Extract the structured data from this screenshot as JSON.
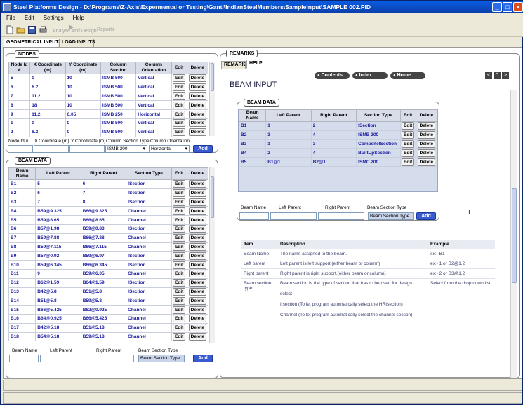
{
  "window": {
    "title": "Steel Platforms Design - D:\\Programs\\Z-Axis\\Expermental or Testing\\Ganti\\IndianSteelMembers\\SampleInput\\SAMPLE 002.PID"
  },
  "menu": [
    "File",
    "Edit",
    "Settings",
    "Help"
  ],
  "toolbar": {
    "analyse_label": "Analyse And Design",
    "reports_label": "Reports"
  },
  "tabs": [
    "GEOMETRICAL INPUTS",
    "LOAD INPUTS"
  ],
  "nodes": {
    "legend": "NODES",
    "headers": [
      "Node Id #",
      "X Coordinate (m)",
      "Y Coordinate (m)",
      "Column Section",
      "Column Orientation",
      "Edit",
      "Delete"
    ],
    "rows": [
      [
        "5",
        "0",
        "10",
        "ISMB 500",
        "Vertical"
      ],
      [
        "6",
        "6.2",
        "10",
        "ISMB 500",
        "Vertical"
      ],
      [
        "7",
        "11.2",
        "10",
        "ISMB 500",
        "Vertical"
      ],
      [
        "8",
        "18",
        "10",
        "ISMB 500",
        "Vertical"
      ],
      [
        "9",
        "11.2",
        "6.05",
        "ISMB 250",
        "Horizontal"
      ],
      [
        "1",
        "0",
        "0",
        "ISMB 500",
        "Vertical"
      ],
      [
        "2",
        "6.2",
        "0",
        "ISMB 500",
        "Vertical"
      ]
    ],
    "form": {
      "node_id_label": "Node Id #",
      "x_label": "X Coordinate (m)",
      "y_label": "Y Coordinate (m)",
      "section_label": "Column Section Type",
      "orientation_label": "Column Orientation",
      "section_value": "ISMB 200",
      "orientation_value": "Horizontal",
      "add": "Add"
    }
  },
  "edit_label": "Edit",
  "delete_label": "Delete",
  "beams": {
    "legend": "BEAM DATA",
    "headers": [
      "Beam Name",
      "Left Parent",
      "Right Parent",
      "Section Type",
      "Edit",
      "Delete"
    ],
    "rows": [
      [
        "B1",
        "5",
        "6",
        "ISection"
      ],
      [
        "B2",
        "6",
        "7",
        "ISection"
      ],
      [
        "B3",
        "7",
        "8",
        "ISection"
      ],
      [
        "B4",
        "B59@9.325",
        "B66@9.325",
        "Channel"
      ],
      [
        "B5",
        "B59@8.65",
        "B66@8.65",
        "Channel"
      ],
      [
        "B6",
        "B57@1.98",
        "B59@0.83",
        "ISection"
      ],
      [
        "B7",
        "B59@7.88",
        "B66@7.88",
        "Channel"
      ],
      [
        "B8",
        "B59@7.115",
        "B66@7.115",
        "Channel"
      ],
      [
        "B9",
        "B57@0.92",
        "B59@6.97",
        "ISection"
      ],
      [
        "B10",
        "B59@6.345",
        "B66@6.345",
        "ISection"
      ],
      [
        "B11",
        "9",
        "B59@6.05",
        "Channel"
      ],
      [
        "B12",
        "B62@1.59",
        "B64@1.59",
        "ISection"
      ],
      [
        "B13",
        "B42@5.8",
        "B51@5.8",
        "ISection"
      ],
      [
        "B14",
        "B51@5.8",
        "B59@5.8",
        "ISection"
      ],
      [
        "B15",
        "B66@5.425",
        "B62@0.925",
        "Channel"
      ],
      [
        "B16",
        "B64@0.925",
        "B66@5.425",
        "Channel"
      ],
      [
        "B17",
        "B42@5.18",
        "B51@5.18",
        "Channel"
      ],
      [
        "B18",
        "B54@5.18",
        "B59@5.18",
        "Channel"
      ]
    ],
    "form": {
      "name_label": "Beam Name",
      "left_label": "Left Parent",
      "right_label": "Right Parent",
      "section_label": "Beam Section Type",
      "section_value": "Beam Section Type",
      "add": "Add"
    }
  },
  "remarks": {
    "legend": "REMARKS",
    "tabs": [
      "REMARKS",
      "HELP"
    ],
    "nav": [
      "Contents",
      "Index",
      "Home"
    ],
    "nav_arrows": [
      "<",
      "^",
      ">"
    ],
    "heading": "BEAM INPUT",
    "sample": {
      "legend": "BEAM DATA",
      "headers": [
        "Beam Name",
        "Left Parent",
        "Right Parent",
        "Section Type",
        "Edit",
        "Delete"
      ],
      "rows": [
        [
          "B1",
          "1",
          "2",
          "ISection"
        ],
        [
          "B2",
          "3",
          "4",
          "ISMB 200"
        ],
        [
          "B3",
          "1",
          "3",
          "CompsiteISection"
        ],
        [
          "B4",
          "2",
          "4",
          "BuiltUpSection"
        ],
        [
          "B5",
          "B1@1",
          "B2@1",
          "ISMC 200"
        ]
      ],
      "form": {
        "name_label": "Beam Name",
        "left_label": "Left Parent",
        "right_label": "Right Parent",
        "section_label": "Beam Section Type",
        "section_value": "Beam Section Type",
        "add": "Add"
      }
    },
    "desc_headers": [
      "Item",
      "Description",
      "Example"
    ],
    "desc_rows": [
      {
        "item": "Beam Name",
        "desc": "The name assigned to the beam.",
        "example": "ex:- B1"
      },
      {
        "item": "Left parent",
        "desc": "Left parent is left support.(either beam or column)",
        "example": "ex:- 1 or B2@1.2"
      },
      {
        "item": "Right parent",
        "desc": "Right parent is right support.(either beam or column)",
        "example": "ex:- 2 or B3@1.2"
      },
      {
        "item": "Beam section type",
        "desc": "Beam section is the type of section that has to be used for design.",
        "desc2": "select",
        "desc3": "I section (To let program automatically select the HRIsection)",
        "desc4": "Channel (To let program automatically select the channel section)",
        "example": "Select from the drop down list."
      }
    ]
  }
}
